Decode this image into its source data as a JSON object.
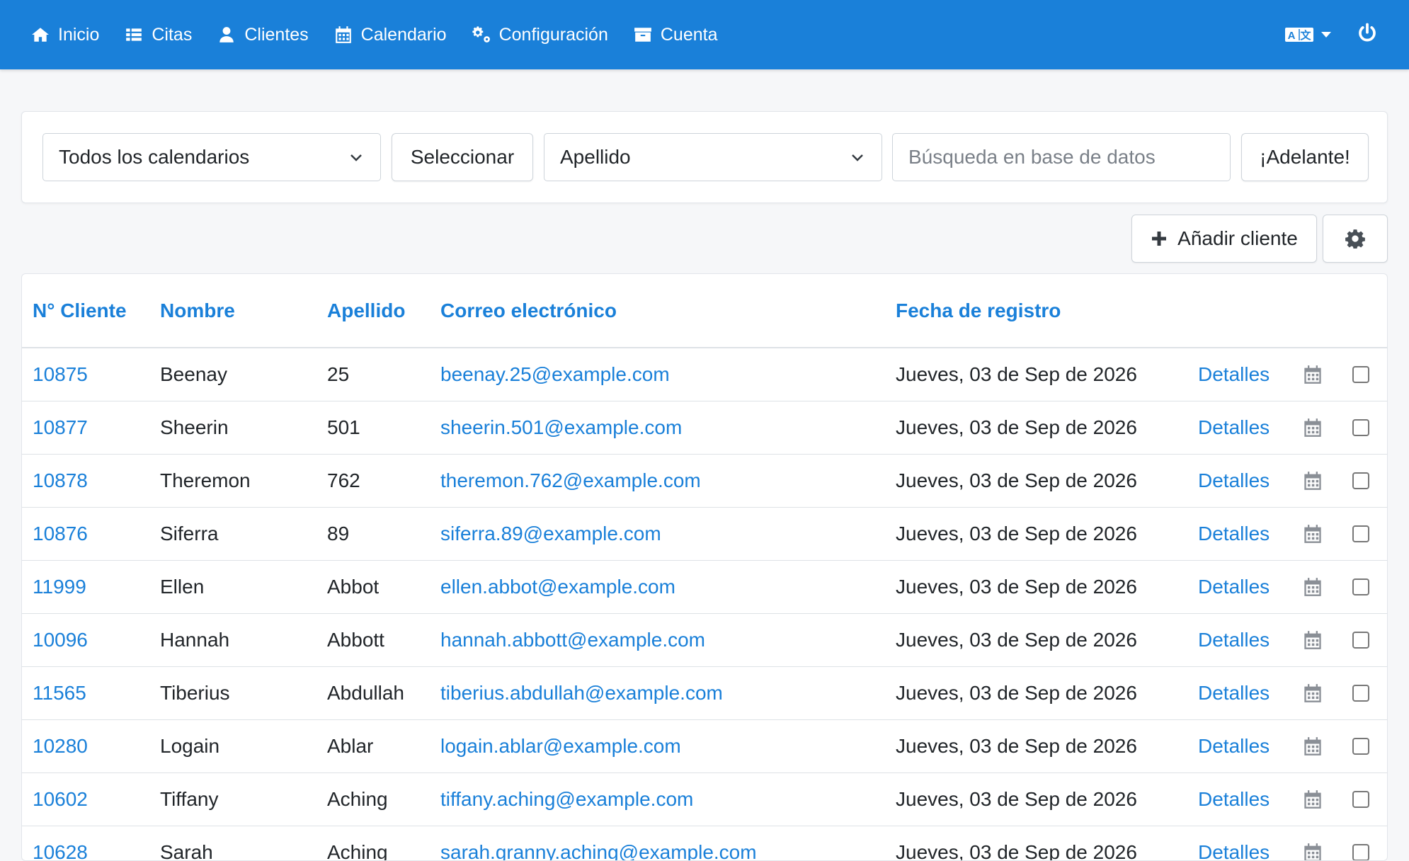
{
  "nav": {
    "items": [
      {
        "label": "Inicio",
        "icon": "home-icon"
      },
      {
        "label": "Citas",
        "icon": "list-icon"
      },
      {
        "label": "Clientes",
        "icon": "user-icon"
      },
      {
        "label": "Calendario",
        "icon": "calendar-icon"
      },
      {
        "label": "Configuración",
        "icon": "cogs-icon"
      },
      {
        "label": "Cuenta",
        "icon": "archive-icon"
      }
    ],
    "language_icon": "language-icon",
    "power_icon": "power-icon"
  },
  "filter": {
    "calendar_select": "Todos los calendarios",
    "select_button": "Seleccionar",
    "field_select": "Apellido",
    "search_placeholder": "Búsqueda en base de datos",
    "go_button": "¡Adelante!"
  },
  "actions": {
    "add_client": "Añadir cliente",
    "settings_icon": "gear-icon"
  },
  "table": {
    "headers": {
      "id": "N° Cliente",
      "first_name": "Nombre",
      "last_name": "Apellido",
      "email": "Correo electrónico",
      "registered": "Fecha de registro"
    },
    "details_label": "Detalles",
    "rows": [
      {
        "id": "10875",
        "first_name": "Beenay",
        "last_name": "25",
        "email": "beenay.25@example.com",
        "registered": "Jueves, 03 de Sep de 2026"
      },
      {
        "id": "10877",
        "first_name": "Sheerin",
        "last_name": "501",
        "email": "sheerin.501@example.com",
        "registered": "Jueves, 03 de Sep de 2026"
      },
      {
        "id": "10878",
        "first_name": "Theremon",
        "last_name": "762",
        "email": "theremon.762@example.com",
        "registered": "Jueves, 03 de Sep de 2026"
      },
      {
        "id": "10876",
        "first_name": "Siferra",
        "last_name": "89",
        "email": "siferra.89@example.com",
        "registered": "Jueves, 03 de Sep de 2026"
      },
      {
        "id": "11999",
        "first_name": "Ellen",
        "last_name": "Abbot",
        "email": "ellen.abbot@example.com",
        "registered": "Jueves, 03 de Sep de 2026"
      },
      {
        "id": "10096",
        "first_name": "Hannah",
        "last_name": "Abbott",
        "email": "hannah.abbott@example.com",
        "registered": "Jueves, 03 de Sep de 2026"
      },
      {
        "id": "11565",
        "first_name": "Tiberius",
        "last_name": "Abdullah",
        "email": "tiberius.abdullah@example.com",
        "registered": "Jueves, 03 de Sep de 2026"
      },
      {
        "id": "10280",
        "first_name": "Logain",
        "last_name": "Ablar",
        "email": "logain.ablar@example.com",
        "registered": "Jueves, 03 de Sep de 2026"
      },
      {
        "id": "10602",
        "first_name": "Tiffany",
        "last_name": "Aching",
        "email": "tiffany.aching@example.com",
        "registered": "Jueves, 03 de Sep de 2026"
      },
      {
        "id": "10628",
        "first_name": "Sarah",
        "last_name": "Aching",
        "email": "sarah.granny.aching@example.com",
        "registered": "Jueves, 03 de Sep de 2026"
      }
    ]
  },
  "colors": {
    "navbar": "#1a80d9",
    "link": "#1a80d9"
  }
}
